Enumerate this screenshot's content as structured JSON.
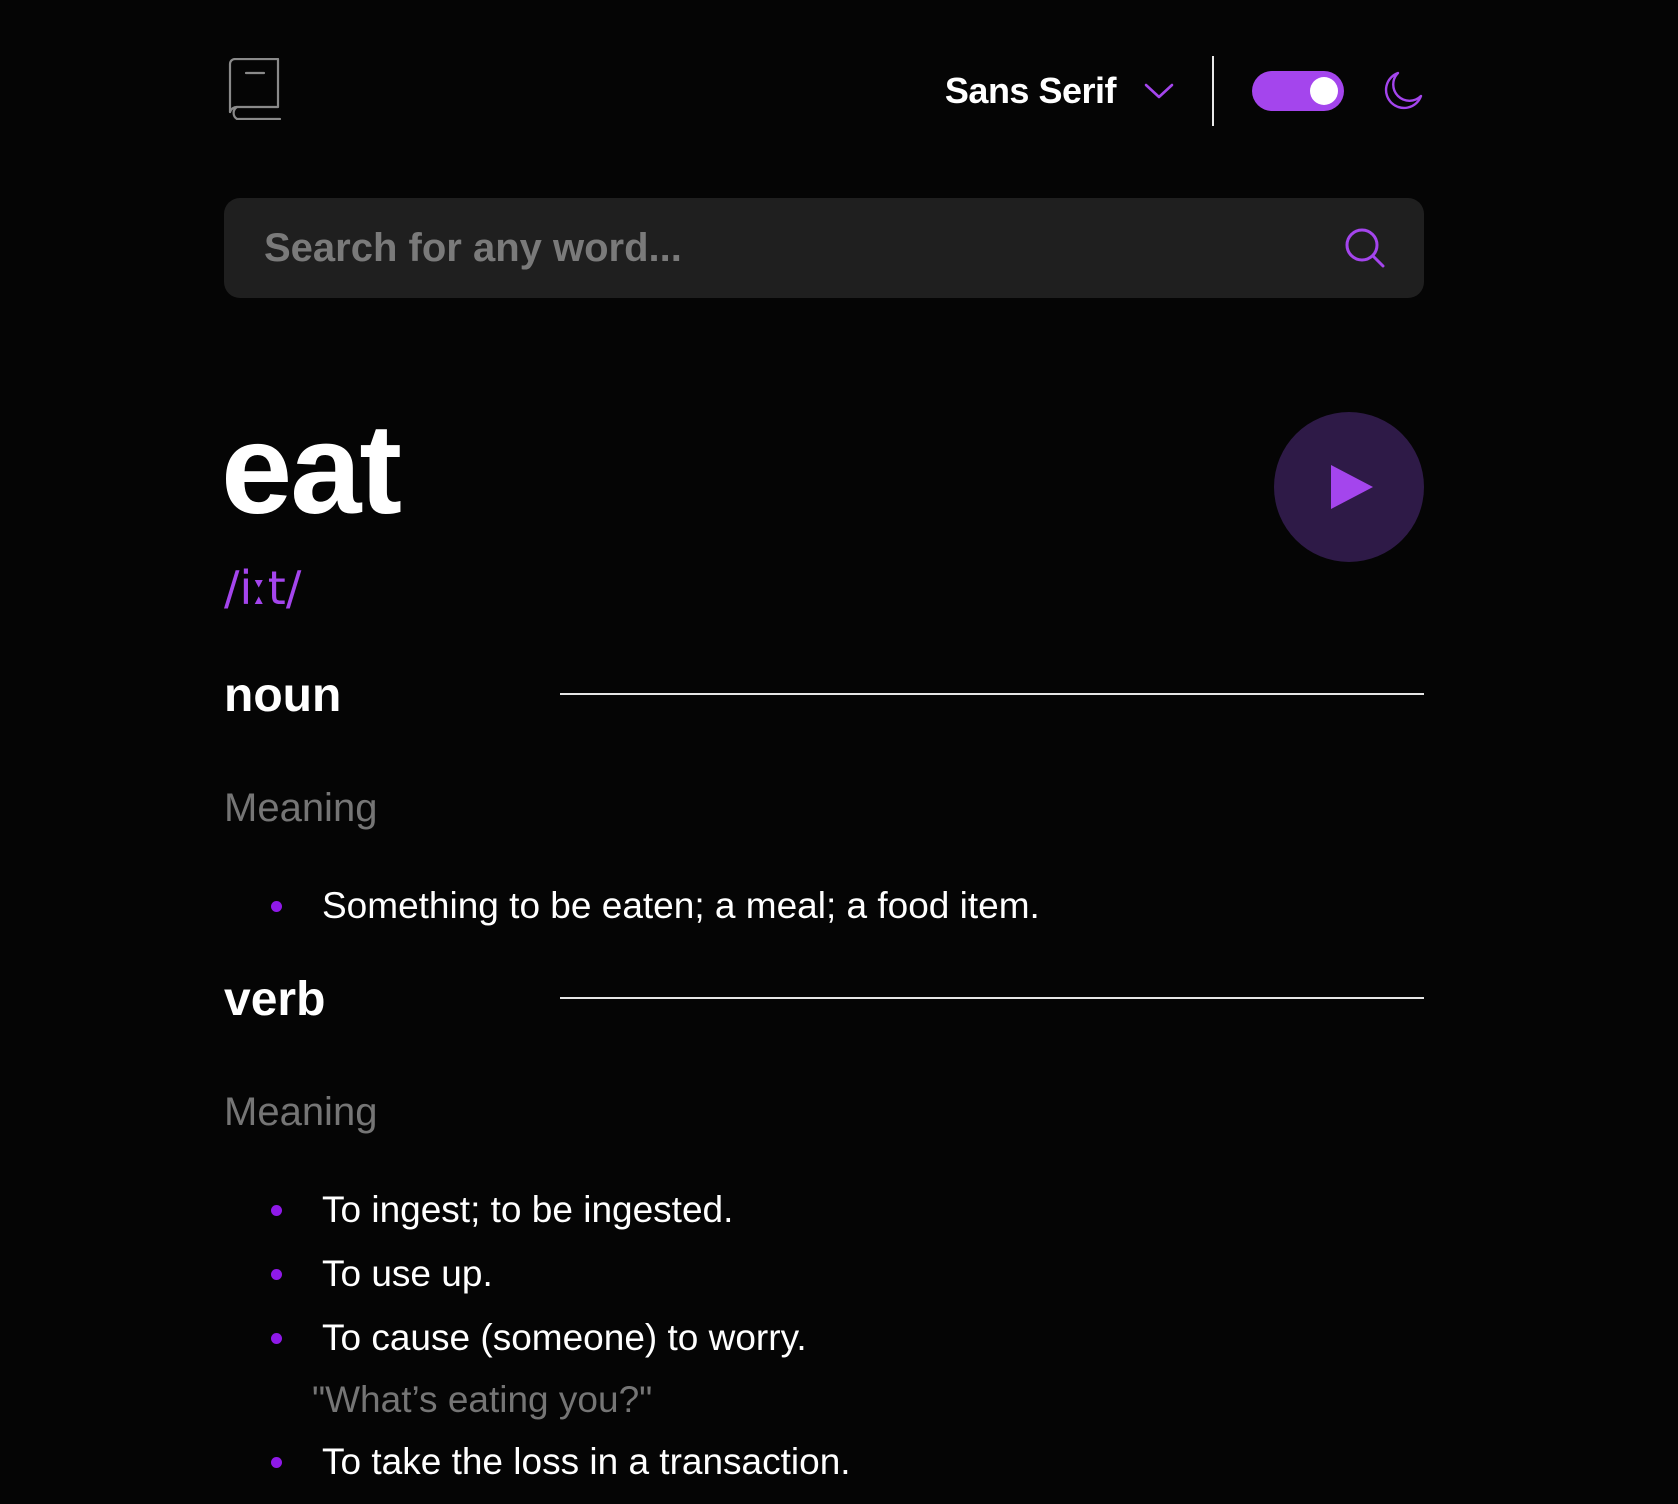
{
  "header": {
    "logo_icon": "book-icon",
    "font_selector": {
      "selected": "Sans Serif",
      "icon": "chevron-down-icon"
    },
    "theme_toggle": {
      "state": "on",
      "icon": "moon-icon"
    }
  },
  "search": {
    "placeholder": "Search for any word...",
    "value": "",
    "icon": "search-icon"
  },
  "word": {
    "text": "eat",
    "phonetic": "/iːt/",
    "play_icon": "play-icon"
  },
  "meanings": [
    {
      "part_of_speech": "noun",
      "meaning_label": "Meaning",
      "definitions": [
        {
          "text": "Something to be eaten; a meal; a food item."
        }
      ]
    },
    {
      "part_of_speech": "verb",
      "meaning_label": "Meaning",
      "definitions": [
        {
          "text": "To ingest; to be ingested."
        },
        {
          "text": "To use up."
        },
        {
          "text": "To cause (someone) to worry.",
          "example": "\"What’s eating you?\""
        },
        {
          "text": "To take the loss in a transaction."
        }
      ]
    }
  ],
  "colors": {
    "background": "#050505",
    "accent": "#a445ed",
    "search_bg": "#1f1f1f",
    "muted_text": "#757575",
    "play_bg": "#2e1a47"
  }
}
